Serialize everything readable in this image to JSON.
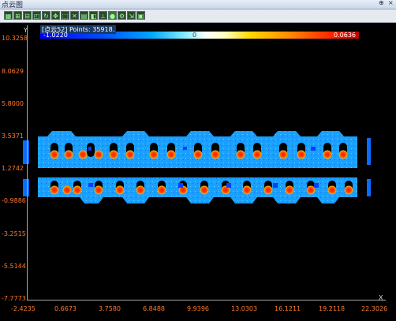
{
  "window": {
    "title": "点云图",
    "pin_icon": "pin-icon",
    "close_icon": "close-icon"
  },
  "toolbar": {
    "icons": [
      "grid-icon",
      "zoom-in-icon",
      "zoom-out-icon",
      "fit-icon",
      "rotate-icon",
      "pan-icon",
      "select-icon",
      "delete-icon",
      "layer-icon",
      "color-icon",
      "measure-icon",
      "point-icon",
      "settings-icon",
      "save-icon"
    ]
  },
  "legend": {
    "title": "[点云52] Points: 35918.",
    "min": "-1.0220",
    "mid": "0",
    "max": "0.0636"
  },
  "axes": {
    "y_name": "Y",
    "x_name": "X",
    "y_ticks": [
      "10.3258",
      "8.0629",
      "5.8000",
      "3.5371",
      "1.2742",
      "-0.9886",
      "-3.2515",
      "-5.5144",
      "-7.7773"
    ],
    "x_ticks": [
      "-2.4235",
      "0.6673",
      "3.7580",
      "6.8488",
      "9.9396",
      "13.0303",
      "16.1211",
      "19.2118",
      "22.3026"
    ]
  },
  "colors": {
    "background": "#000000",
    "tick_label": "#ff7a2a",
    "surface_blue": "#1aa0ff",
    "hot_red": "#ff2000"
  }
}
